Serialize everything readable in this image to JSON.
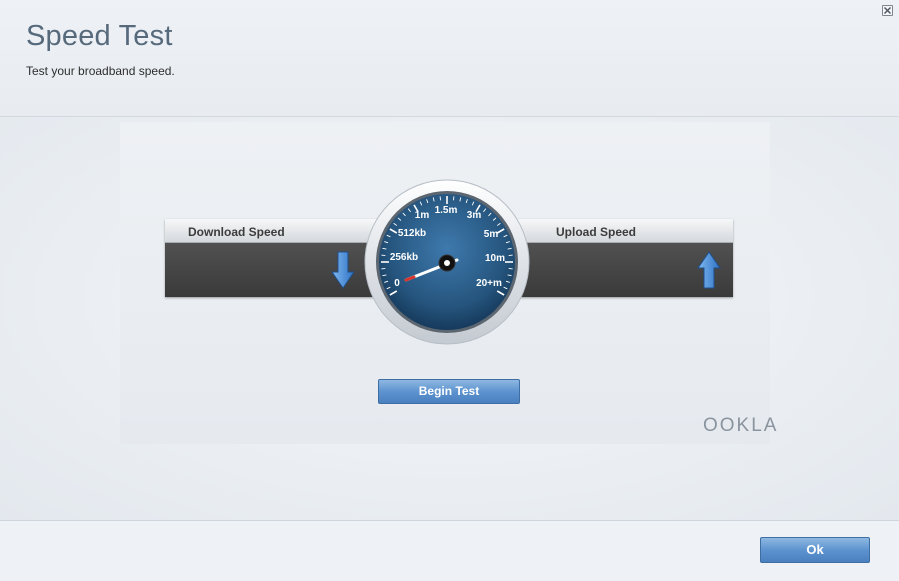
{
  "header": {
    "title": "Speed Test",
    "subtitle": "Test your broadband speed."
  },
  "download": {
    "label": "Download Speed",
    "arrow_icon": "arrow-down-icon"
  },
  "upload": {
    "label": "Upload Speed",
    "arrow_icon": "arrow-up-icon"
  },
  "gauge": {
    "scale_labels": [
      "0",
      "256kb",
      "512kb",
      "1m",
      "1.5m",
      "3m",
      "5m",
      "10m",
      "20+m"
    ],
    "needle_value": "0"
  },
  "actions": {
    "begin_test_label": "Begin Test",
    "ok_label": "Ok"
  },
  "brand": {
    "logo_text": "OOKLA"
  },
  "colors": {
    "accent": "#5d93cf",
    "gauge_face": "#2a5d8f",
    "arrow": "#4a8fd8"
  }
}
